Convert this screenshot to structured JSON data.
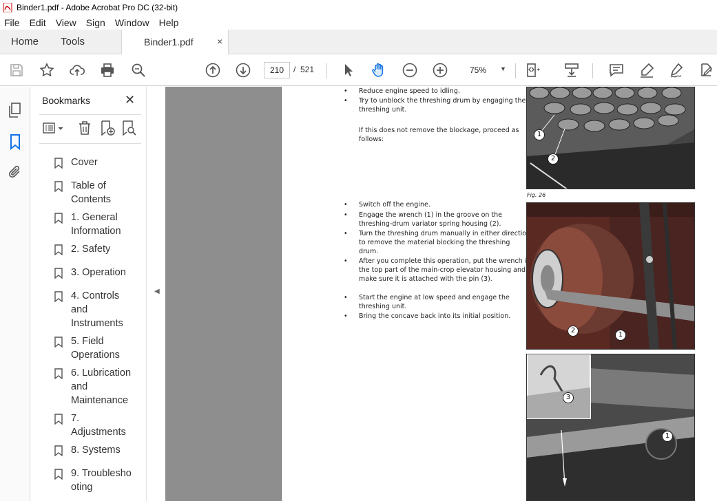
{
  "window": {
    "title": "Binder1.pdf - Adobe Acrobat Pro DC (32-bit)"
  },
  "menu": [
    "File",
    "Edit",
    "View",
    "Sign",
    "Window",
    "Help"
  ],
  "tabs": {
    "home": "Home",
    "tools": "Tools",
    "document": "Binder1.pdf",
    "close_symbol": "×"
  },
  "toolbar": {
    "current_page": "210",
    "page_separator": "/",
    "total_pages": "521",
    "zoom": "75%",
    "icons": [
      "save-icon",
      "bookmark-star-icon",
      "upload-icon",
      "print-icon",
      "search-icon",
      "page-up-icon",
      "page-down-icon",
      "select-cursor-icon",
      "hand-tool-icon",
      "zoom-out-icon",
      "zoom-in-icon",
      "fit-page-icon",
      "scroll-mode-icon",
      "comment-icon",
      "highlight-icon",
      "sign-icon",
      "edit-icon"
    ]
  },
  "bookmarks": {
    "title": "Bookmarks",
    "close_symbol": "✕",
    "items": [
      "Cover",
      "Table of Contents",
      "1. General Information",
      "2. Safety",
      "3. Operation",
      "4. Controls and Instruments",
      "5. Field Operations",
      "6. Lubrication and Maintenance",
      "7. Adjustments",
      "8. Systems",
      "9. Troubleshooting"
    ]
  },
  "document": {
    "block1": [
      "Reduce engine speed to idling.",
      "Try to unblock the threshing drum by engaging the threshing unit."
    ],
    "block1_note": "If this does not remove the blockage, proceed as follows:",
    "block2": [
      "Switch off the engine.",
      "Engage the wrench (1) in the groove on the threshing-drum variator spring housing (2).",
      "Turn the threshing drum manually in either direction to remove the material blocking the threshing drum.",
      "After you complete this operation, put the wrench in the top part of the main-crop elevator housing and make sure it is attached with the pin (3).",
      "Start the engine at low speed and engage the threshing unit.",
      "Bring the concave back into its initial position."
    ],
    "bullet_symbol": "•",
    "fig_caption": "Fig. 26",
    "callouts": {
      "fig1": [
        "1",
        "2"
      ],
      "fig2": [
        "2",
        "1"
      ],
      "fig3": [
        "3",
        "1"
      ]
    }
  }
}
